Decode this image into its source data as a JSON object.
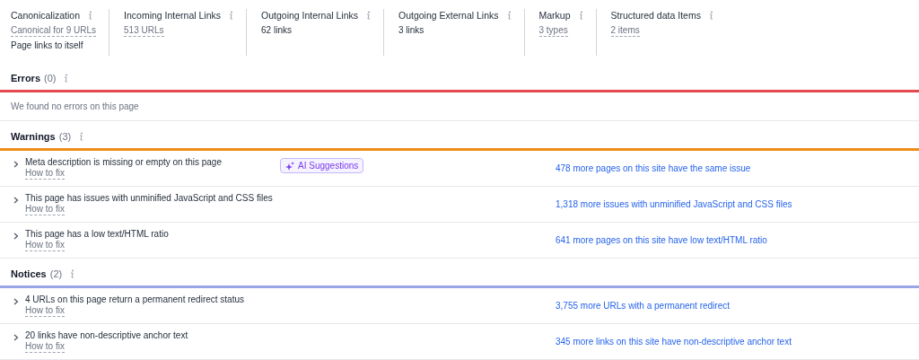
{
  "stats": [
    {
      "label": "Canonicalization",
      "values": [
        {
          "kind": "link",
          "text": "Canonical for 9 URLs"
        },
        {
          "kind": "plain",
          "text": "Page links to itself"
        }
      ]
    },
    {
      "label": "Incoming Internal Links",
      "values": [
        {
          "kind": "link",
          "text": "513 URLs"
        }
      ]
    },
    {
      "label": "Outgoing Internal Links",
      "values": [
        {
          "kind": "plain",
          "text": "62 links"
        }
      ]
    },
    {
      "label": "Outgoing External Links",
      "values": [
        {
          "kind": "plain",
          "text": "3 links"
        }
      ]
    },
    {
      "label": "Markup",
      "values": [
        {
          "kind": "link",
          "text": "3 types"
        }
      ]
    },
    {
      "label": "Structured data Items",
      "values": [
        {
          "kind": "link",
          "text": "2 items"
        }
      ]
    }
  ],
  "sections": [
    {
      "title": "Errors",
      "count": "(0)",
      "color": "#e5484d",
      "empty_text": "We found no errors on this page"
    },
    {
      "title": "Warnings",
      "count": "(3)",
      "color": "#f08c1a",
      "issues": [
        {
          "text": "Meta description is missing or empty on this page",
          "fix": "How to fix",
          "ai_button": "AI Suggestions",
          "more": "478 more pages on this site have the same issue"
        },
        {
          "text": "This page has issues with unminified JavaScript and CSS files",
          "fix": "How to fix",
          "more": "1,318 more issues with unminified JavaScript and CSS files"
        },
        {
          "text": "This page has a low text/HTML ratio",
          "fix": "How to fix",
          "more": "641 more pages on this site have low text/HTML ratio"
        }
      ]
    },
    {
      "title": "Notices",
      "count": "(2)",
      "color": "#9aa5e8",
      "issues": [
        {
          "text": "4 URLs on this page return a permanent redirect status",
          "fix": "How to fix",
          "more": "3,755 more URLs with a permanent redirect"
        },
        {
          "text": "20 links have non-descriptive anchor text",
          "fix": "How to fix",
          "more": "345 more links on this site have non-descriptive anchor text"
        }
      ]
    }
  ]
}
